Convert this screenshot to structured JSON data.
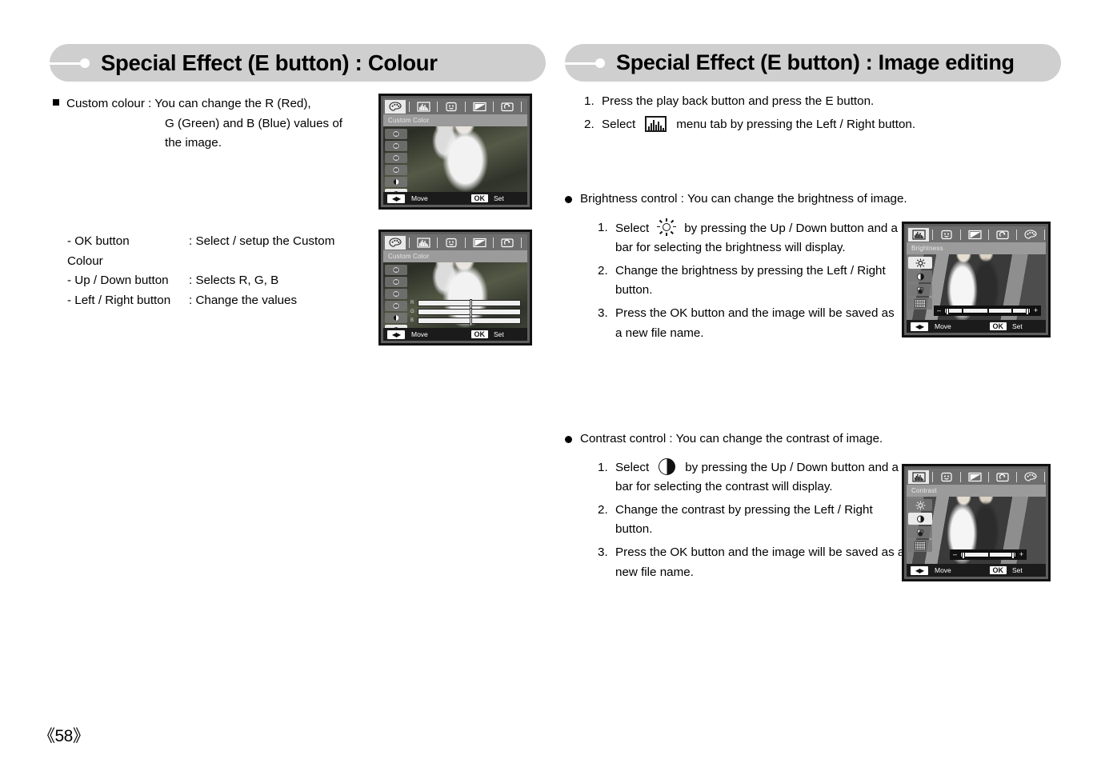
{
  "page": {
    "number": "《58》"
  },
  "left": {
    "header": {
      "title": "Special Effect (E button) : Colour"
    },
    "bullet": {
      "line1": "Custom colour : You can change the R (Red),",
      "line2": "G (Green) and B (Blue) values of",
      "line3": "the image."
    },
    "keys": [
      {
        "key": "- OK button",
        "value": ": Select / setup the Custom",
        "value2": "Colour"
      },
      {
        "key": "- Up / Down button",
        "value": ": Selects R, G, B",
        "value2": ""
      },
      {
        "key": "- Left / Right button",
        "value": ": Change the values",
        "value2": ""
      }
    ],
    "lcd1": {
      "title": "Custom Color",
      "move_label": "Move",
      "ok_label": "OK",
      "set_label": "Set",
      "tabs": [
        "palette-icon",
        "histogram-icon",
        "smiley-icon",
        "resize-icon",
        "rotate-icon"
      ],
      "active_tab": 0,
      "side_items": [
        "colour-preset-1",
        "colour-preset-2",
        "colour-preset-3",
        "colour-preset-4",
        "contrast-preset",
        "custom-colour"
      ],
      "active_side": 5
    },
    "lcd2": {
      "title": "Custom Color",
      "move_label": "Move",
      "ok_label": "OK",
      "set_label": "Set",
      "tabs": [
        "palette-icon",
        "histogram-icon",
        "smiley-icon",
        "resize-icon",
        "rotate-icon"
      ],
      "active_tab": 0,
      "side_items": [
        "colour-preset-1",
        "colour-preset-2",
        "colour-preset-3",
        "colour-preset-4",
        "contrast-preset",
        "custom-colour"
      ],
      "active_side": 5,
      "rgb": [
        {
          "label": "R",
          "position": 50
        },
        {
          "label": "G",
          "position": 50
        },
        {
          "label": "B",
          "position": 50
        }
      ]
    }
  },
  "right": {
    "header": {
      "title": "Special Effect (E button) : Image editing"
    },
    "steps_top": [
      {
        "num": "1.",
        "text": "Press the play back button and press the E button."
      },
      {
        "num": "2.",
        "pre": "Select",
        "icon": "histogram-icon",
        "post": "menu tab by pressing the Left / Right button."
      }
    ],
    "brightness": {
      "title": "Brightness control : You can change the brightness of image.",
      "steps": [
        {
          "num": "1.",
          "pre": "Select",
          "icon": "sun-icon",
          "post": "by pressing the Up / Down button and a bar for selecting the brightness will display."
        },
        {
          "num": "2.",
          "text": "Change the brightness by pressing the Left / Right button."
        },
        {
          "num": "3.",
          "text": "Press the OK button and the image will be saved as a new file name."
        }
      ],
      "lcd": {
        "title": "Brightness",
        "move_label": "Move",
        "ok_label": "OK",
        "set_label": "Set",
        "tabs": [
          "histogram-icon",
          "smiley-icon",
          "resize-icon",
          "rotate-icon",
          "palette-icon"
        ],
        "active_tab": 0,
        "side_items": [
          "sun-icon",
          "contrast-icon",
          "saturation-icon",
          "noise-icon"
        ],
        "active_side": 0,
        "slider": {
          "minus": "–",
          "plus": "+",
          "value": 50
        }
      }
    },
    "contrast": {
      "title": "Contrast control : You can change the contrast of image.",
      "steps": [
        {
          "num": "1.",
          "pre": "Select",
          "icon": "contrast-icon",
          "post": "by pressing the Up / Down button and a bar for selecting the contrast will display."
        },
        {
          "num": "2.",
          "text": "Change the contrast by pressing the Left / Right button."
        },
        {
          "num": "3.",
          "text": "Press the OK button and the image will be saved as a new file name."
        }
      ],
      "lcd": {
        "title": "Contrast",
        "move_label": "Move",
        "ok_label": "OK",
        "set_label": "Set",
        "tabs": [
          "histogram-icon",
          "smiley-icon",
          "resize-icon",
          "rotate-icon",
          "palette-icon"
        ],
        "active_tab": 0,
        "side_items": [
          "sun-icon",
          "contrast-icon",
          "saturation-icon",
          "noise-icon"
        ],
        "active_side": 1,
        "slider": {
          "minus": "–",
          "plus": "+",
          "value": 50
        }
      }
    }
  },
  "colors": {
    "header_bg": "#cfcfcf",
    "lcd_frame": "#111111",
    "lcd_tabbar": "#6e6e6e",
    "lcd_titlebar": "#9b9b9b",
    "lcd_bottombar": "#1b1b1b"
  }
}
